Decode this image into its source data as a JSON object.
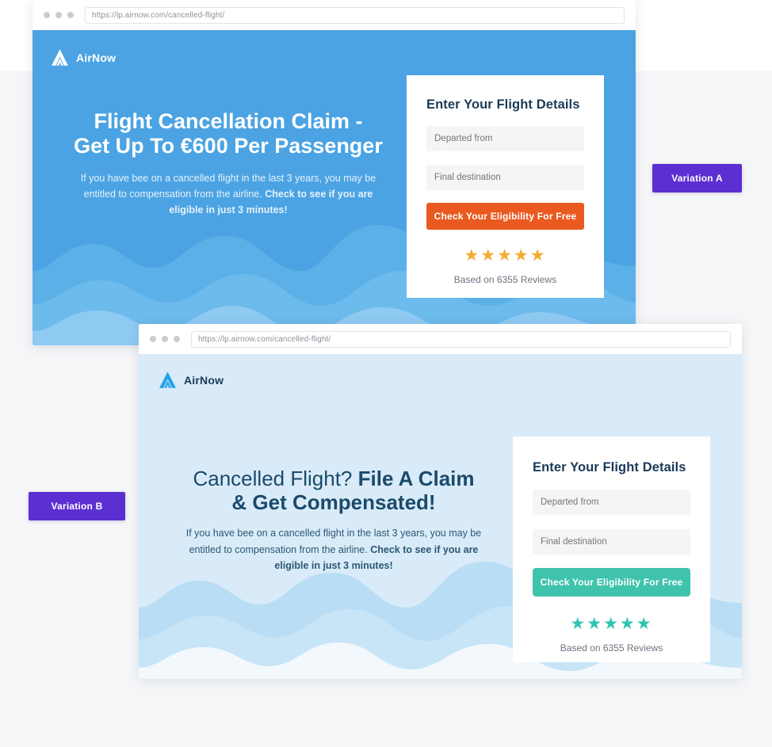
{
  "background_color": "#f5f6f8",
  "variation_a": {
    "badge_label": "Variation A",
    "browser": {
      "url": "https://lp.airnow.com/cancelled-flight/"
    },
    "brand_name": "AirNow",
    "hero": {
      "headline_line1": "Flight Cancellation Claim -",
      "headline_line2": "Get Up To €600 Per Passenger",
      "body_normal": "If you have bee on a cancelled flight in the last 3 years, you may be entitled to compensation from the airline. ",
      "body_bold": "Check to see if you are eligible in just 3 minutes!"
    },
    "form": {
      "title": "Enter Your Flight Details",
      "departed_placeholder": "Departed from",
      "departed_value": "",
      "destination_placeholder": "Final destination",
      "destination_value": "",
      "cta_label": "Check Your Eligibility For Free",
      "stars": "★★★★★",
      "star_count": 5,
      "reviews_text": "Based on 6355 Reviews",
      "review_count": 6355
    },
    "colors": {
      "page_background": "#4ba3e3",
      "cta": "#ea5a20",
      "stars": "#f0ad2e",
      "heading": "#1b3a57"
    }
  },
  "variation_b": {
    "badge_label": "Variation B",
    "browser": {
      "url": "https://lp.airnow.com/cancelled-flight/"
    },
    "brand_name": "AirNow",
    "hero": {
      "headline_light": "Cancelled Flight? ",
      "headline_bold": "File A Claim",
      "headline_line2": "& Get Compensated!",
      "body_normal": "If you have bee on a cancelled flight in the last 3 years, you may be entitled to compensation from the airline. ",
      "body_bold": "Check to see if you are eligible in just 3 minutes!"
    },
    "form": {
      "title": "Enter Your Flight Details",
      "departed_placeholder": "Departed from",
      "departed_value": "",
      "destination_placeholder": "Final destination",
      "destination_value": "",
      "cta_label": "Check Your Eligibility For Free",
      "stars": "★★★★★",
      "star_count": 5,
      "reviews_text": "Based on 6355 Reviews",
      "review_count": 6355
    },
    "colors": {
      "page_background": "#d9ebf8",
      "cta": "#3fc3ac",
      "stars": "#2ec4b0",
      "heading": "#1b4a6b"
    }
  },
  "badge_color": "#5b2fd1"
}
